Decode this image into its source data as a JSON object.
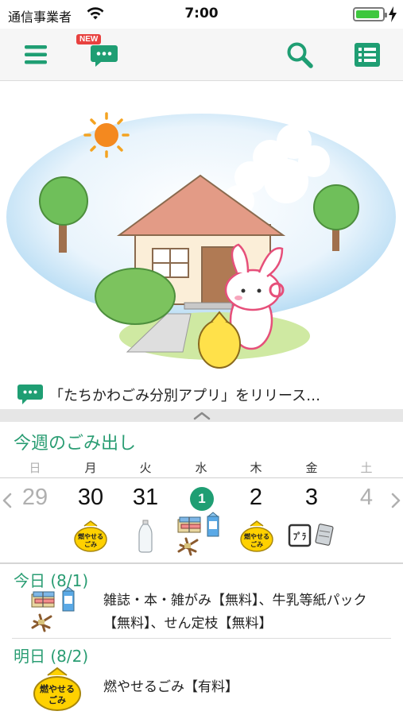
{
  "status_bar": {
    "carrier": "通信事業者",
    "time": "7:00"
  },
  "toolbar": {
    "new_badge": "NEW",
    "icons": [
      "menu-icon",
      "news-chat-icon",
      "search-icon",
      "list-icon"
    ],
    "accent_color": "#1f9e73"
  },
  "news": {
    "text": "「たちかわごみ分別アプリ」をリリース…"
  },
  "illustration": {
    "bag_label": "燃やせるごみ",
    "bag_label_short": "燃やせる\nごみ"
  },
  "week": {
    "title": "今週のごみ出し",
    "days": [
      {
        "weekday": "日",
        "date": "29",
        "dim": true,
        "icons": []
      },
      {
        "weekday": "月",
        "date": "30",
        "dim": false,
        "icons": [
          "burnable-bag-icon"
        ]
      },
      {
        "weekday": "火",
        "date": "31",
        "dim": false,
        "icons": [
          "pet-bottle-icon"
        ]
      },
      {
        "weekday": "水",
        "date": "1",
        "dim": false,
        "today": true,
        "icons": [
          "paper-bundle-icon",
          "milk-carton-icon",
          "pruned-branch-icon"
        ]
      },
      {
        "weekday": "木",
        "date": "2",
        "dim": false,
        "icons": [
          "burnable-bag-icon"
        ]
      },
      {
        "weekday": "金",
        "date": "3",
        "dim": false,
        "icons": [
          "plastic-mark-icon",
          "can-icon"
        ]
      },
      {
        "weekday": "土",
        "date": "4",
        "dim": true,
        "icons": []
      }
    ],
    "bag_text": "燃やせる",
    "bag_text2": "ごみ",
    "plastic_mark": "ﾌﾟﾗ"
  },
  "today": {
    "title": "今日 (8/1)",
    "text": "雑誌・本・雑がみ【無料】、牛乳等紙パック【無料】、せん定枝【無料】"
  },
  "tomorrow": {
    "title": "明日 (8/2)",
    "text": "燃やせるごみ【有料】",
    "bag_text": "燃やせる",
    "bag_text2": "ごみ"
  }
}
